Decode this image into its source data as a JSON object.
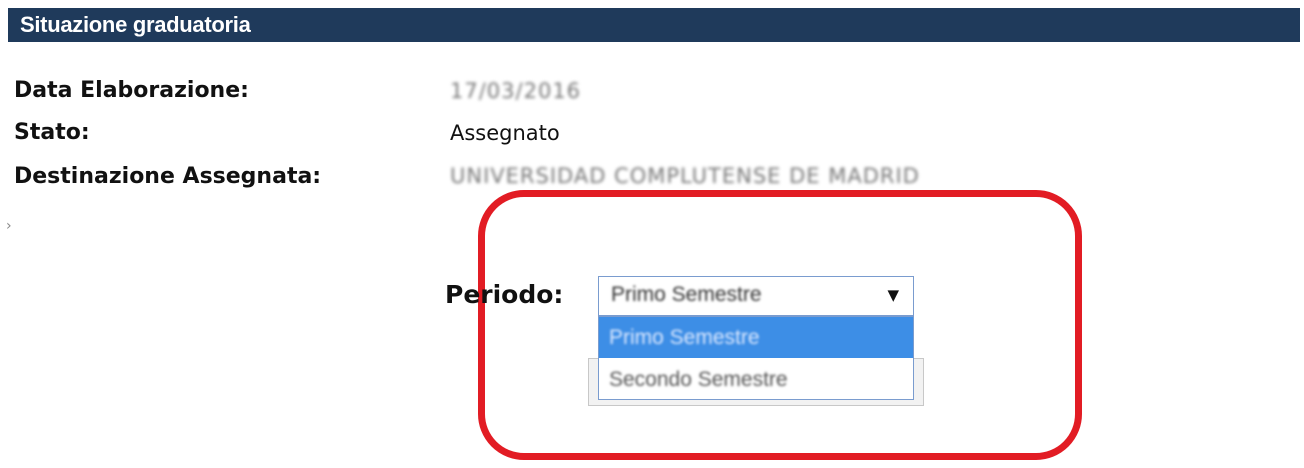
{
  "header": {
    "title": "Situazione graduatoria"
  },
  "fields": {
    "data_elaborazione": {
      "label": "Data Elaborazione:",
      "value": "17/03/2016"
    },
    "stato": {
      "label": "Stato:",
      "value": "Assegnato"
    },
    "destinazione": {
      "label": "Destinazione Assegnata:",
      "value": "UNIVERSIDAD COMPLUTENSE DE MADRID"
    }
  },
  "periodo": {
    "label": "Periodo:",
    "selected": "Primo Semestre",
    "arrow": "▼",
    "options": [
      "Primo Semestre",
      "Secondo Semestre"
    ]
  },
  "colors": {
    "header_bg": "#1f3a5b",
    "highlight_ring": "#e21c24",
    "option_highlight": "#3d8ee6"
  }
}
